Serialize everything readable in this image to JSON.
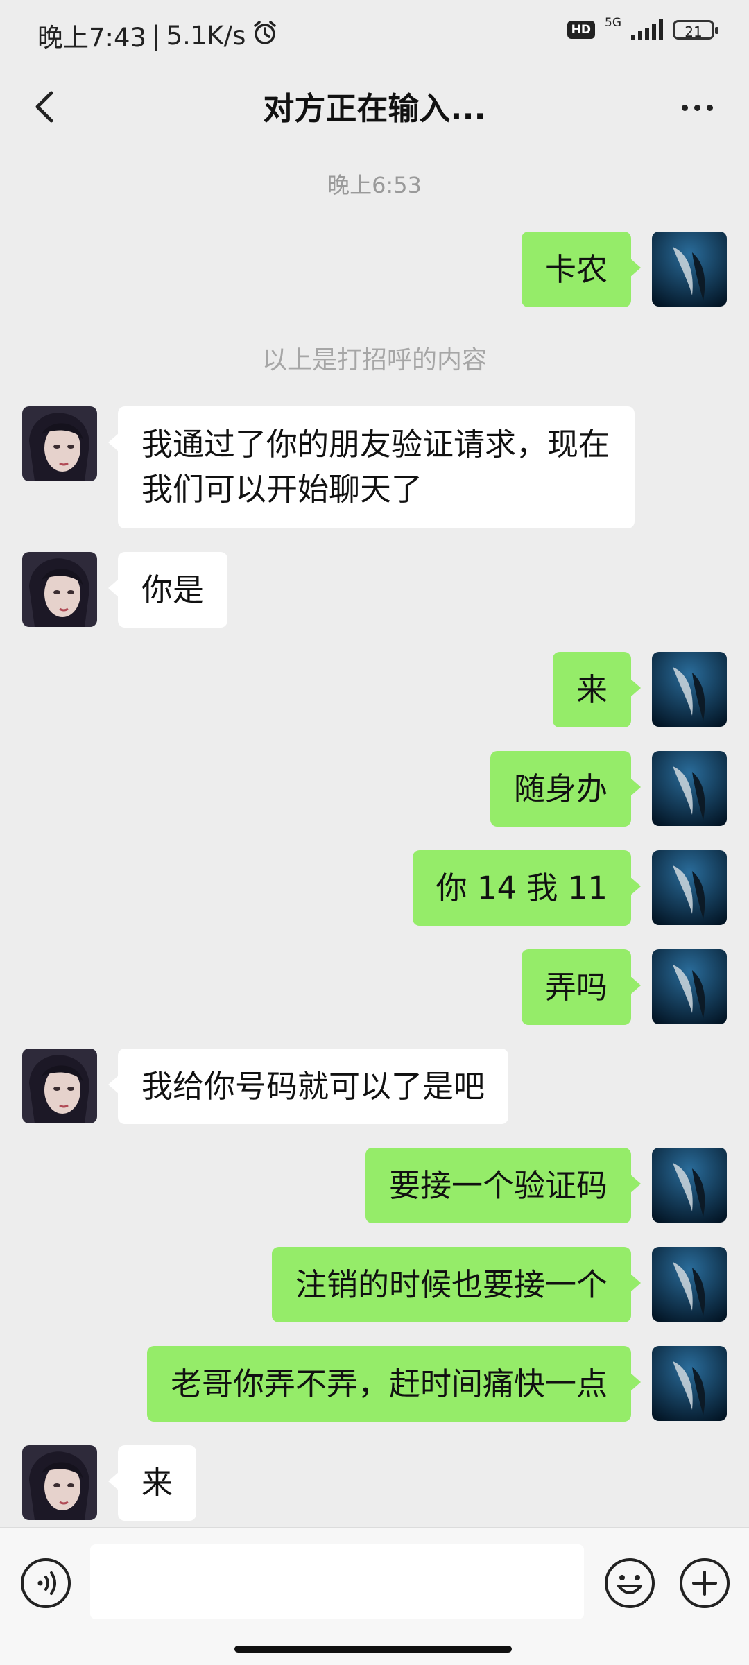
{
  "status": {
    "time": "晚上7:43",
    "separator": "|",
    "speed": "5.1K/s",
    "hd": "HD",
    "network": "5G",
    "battery": "21"
  },
  "nav": {
    "title": "对方正在输入..."
  },
  "chat": {
    "timestamp": "晚上6:53",
    "system_note": "以上是打招呼的内容",
    "messages": [
      {
        "sender": "self",
        "text": "卡农"
      },
      {
        "sender": "other",
        "text": "我通过了你的朋友验证请求，现在\n我们可以开始聊天了"
      },
      {
        "sender": "other",
        "text": "你是"
      },
      {
        "sender": "self",
        "text": "来"
      },
      {
        "sender": "self",
        "text": "随身办"
      },
      {
        "sender": "self",
        "text": "你 14 我 11"
      },
      {
        "sender": "self",
        "text": "弄吗"
      },
      {
        "sender": "other",
        "text": "我给你号码就可以了是吧"
      },
      {
        "sender": "self",
        "text": "要接一个验证码"
      },
      {
        "sender": "self",
        "text": "注销的时候也要接一个"
      },
      {
        "sender": "self",
        "text": "老哥你弄不弄，赶时间痛快一点"
      },
      {
        "sender": "other",
        "text": "来"
      }
    ]
  },
  "colors": {
    "self_bubble": "#95ec69",
    "other_bubble": "#ffffff",
    "background": "#ededed"
  }
}
